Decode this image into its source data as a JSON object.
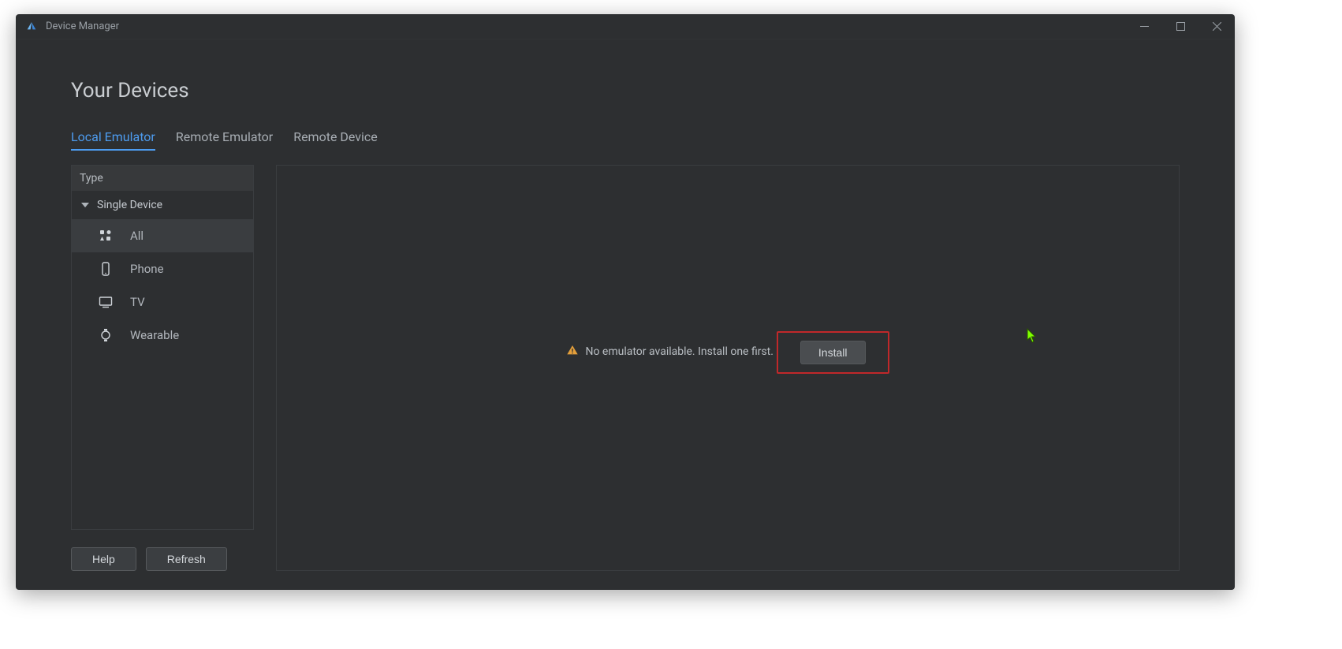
{
  "window": {
    "title": "Device Manager"
  },
  "page": {
    "title": "Your Devices"
  },
  "tabs": {
    "local": "Local Emulator",
    "remote_emulator": "Remote Emulator",
    "remote_device": "Remote Device"
  },
  "sidebar": {
    "header": "Type",
    "group_label": "Single Device",
    "items": {
      "all": "All",
      "phone": "Phone",
      "tv": "TV",
      "wearable": "Wearable"
    }
  },
  "empty": {
    "message": "No emulator available. Install one first.",
    "install_label": "Install"
  },
  "footer": {
    "help": "Help",
    "refresh": "Refresh"
  }
}
